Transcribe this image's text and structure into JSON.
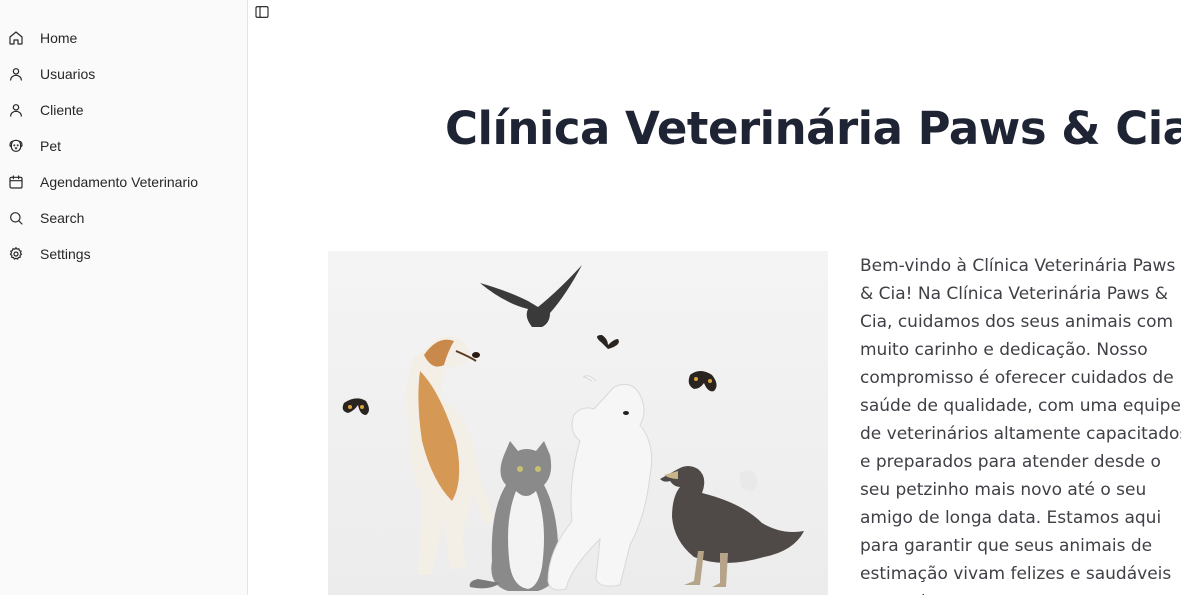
{
  "sidebar": {
    "items": [
      {
        "label": "Home",
        "icon": "home-icon"
      },
      {
        "label": "Usuarios",
        "icon": "user-icon"
      },
      {
        "label": "Cliente",
        "icon": "user-icon"
      },
      {
        "label": "Pet",
        "icon": "dog-icon"
      },
      {
        "label": "Agendamento Veterinario",
        "icon": "calendar-icon"
      },
      {
        "label": "Search",
        "icon": "search-icon"
      },
      {
        "label": "Settings",
        "icon": "gear-icon"
      }
    ]
  },
  "main": {
    "title": "Clínica Veterinária Paws & Cia",
    "hero_image": "pets-group-image",
    "intro": "Bem-vindo à Clínica Veterinária Paws & Cia! Na Clínica Veterinária Paws & Cia, cuidamos dos seus animais com muito carinho e dedicação. Nosso compromisso é oferecer cuidados de saúde de qualidade, com uma equipe de veterinários altamente capacitados e preparados para atender desde o seu petzinho mais novo até o seu amigo de longa data. Estamos aqui para garantir que seus animais de estimação vivam felizes e saudáveis por muitos anos,"
  }
}
